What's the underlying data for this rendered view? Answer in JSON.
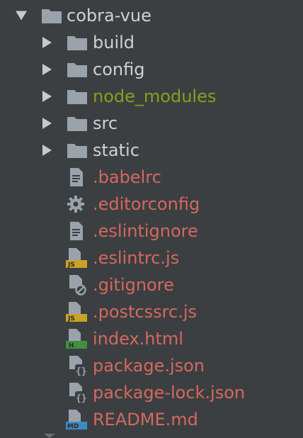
{
  "root": {
    "label": "cobra-vue",
    "expanded": true
  },
  "folders": [
    {
      "label": "build",
      "color": "#cfd1d3"
    },
    {
      "label": "config",
      "color": "#cfd1d3"
    },
    {
      "label": "node_modules",
      "color": "#8d9c1f"
    },
    {
      "label": "src",
      "color": "#cfd1d3"
    },
    {
      "label": "static",
      "color": "#cfd1d3"
    }
  ],
  "files": [
    {
      "label": ".babelrc",
      "icon": "text-file-icon"
    },
    {
      "label": ".editorconfig",
      "icon": "gear-icon"
    },
    {
      "label": ".eslintignore",
      "icon": "text-file-icon"
    },
    {
      "label": ".eslintrc.js",
      "icon": "js-file-icon",
      "badge": "JS"
    },
    {
      "label": ".gitignore",
      "icon": "ignore-file-icon"
    },
    {
      "label": ".postcssrc.js",
      "icon": "js-file-icon",
      "badge": "JS"
    },
    {
      "label": "index.html",
      "icon": "html-file-icon",
      "badge": "H"
    },
    {
      "label": "package.json",
      "icon": "json-file-icon"
    },
    {
      "label": "package-lock.json",
      "icon": "json-file-icon"
    },
    {
      "label": "README.md",
      "icon": "markdown-file-icon",
      "badge": "MD"
    }
  ],
  "colors": {
    "background": "#3c3f41",
    "folder_icon": "#9aa3ab",
    "file_text": "#d4685f",
    "js_badge": "#c9a227",
    "html_badge": "#3f8f3f",
    "md_badge": "#3b8cc4"
  }
}
